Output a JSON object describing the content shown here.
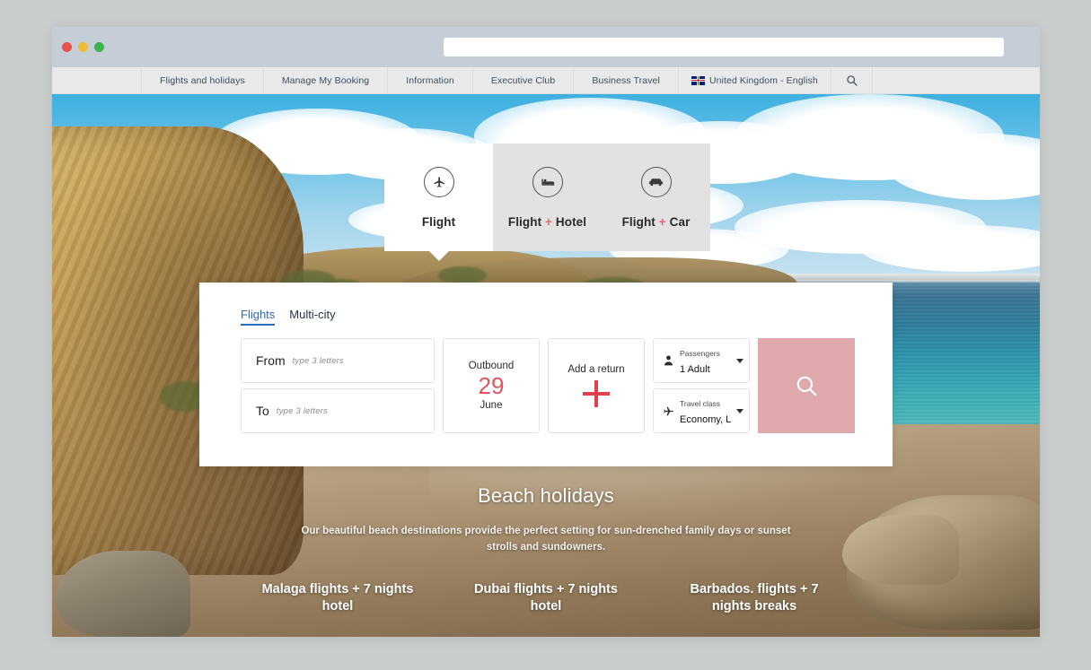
{
  "browser": {
    "url_value": "",
    "url_placeholder": "",
    "traffic_lights": [
      "close",
      "minimize",
      "maximize"
    ]
  },
  "site_nav": {
    "items": [
      {
        "label": "Flights and holidays",
        "name": "flights-and-holidays"
      },
      {
        "label": "Manage My Booking",
        "name": "manage-my-booking"
      },
      {
        "label": "Information",
        "name": "information"
      },
      {
        "label": "Executive Club",
        "name": "executive-club"
      },
      {
        "label": "Business Travel",
        "name": "business-travel"
      }
    ],
    "region": {
      "label": "United Kingdom - English",
      "flag": "uk-flag-icon"
    },
    "search_icon": "search-icon"
  },
  "product_tabs": [
    {
      "label": "Flight",
      "icon": "plane-icon",
      "active": true,
      "plus": false
    },
    {
      "label": "Flight",
      "suffix": "Hotel",
      "icon": "hotel-icon",
      "active": false,
      "plus": true
    },
    {
      "label": "Flight",
      "suffix": "Car",
      "icon": "car-icon",
      "active": false,
      "plus": true
    }
  ],
  "search_card": {
    "tabs": [
      {
        "label": "Flights",
        "active": true
      },
      {
        "label": "Multi-city",
        "active": false
      }
    ],
    "from": {
      "label": "From",
      "value": "",
      "placeholder": "type 3 letters"
    },
    "to": {
      "label": "To",
      "value": "",
      "placeholder": "type 3 letters"
    },
    "outbound": {
      "caption": "Outbound",
      "day": "29",
      "month": "June"
    },
    "return": {
      "caption": "Add a return",
      "icon": "plus-icon"
    },
    "passengers": {
      "label": "Passengers",
      "value": "1 Adult",
      "icon": "person-icon"
    },
    "travel_class": {
      "label": "Travel class",
      "value": "Economy, L",
      "icon": "plane-icon"
    },
    "search_button": {
      "label": "Search",
      "icon": "search-icon"
    }
  },
  "promo": {
    "title": "Beach holidays",
    "subtitle": "Our beautiful beach destinations provide the perfect setting for sun-drenched family days or sunset strolls and sundowners.",
    "links": [
      "Malaga flights + 7 nights hotel",
      "Dubai flights + 7 nights hotel",
      "Barbados. flights + 7 nights breaks"
    ]
  },
  "colors": {
    "page_background": "#c9cecd",
    "browser_chrome": "#c5ced6",
    "nav_background": "#e9e9e9",
    "nav_text": "#3d4f63",
    "accent_pink": "#e0a9ae",
    "accent_red": "#e0414e",
    "date_red": "#e05560",
    "link_blue": "#2b6cb8",
    "card_background": "#ffffff",
    "tab_inactive": "#e2e2e2"
  }
}
